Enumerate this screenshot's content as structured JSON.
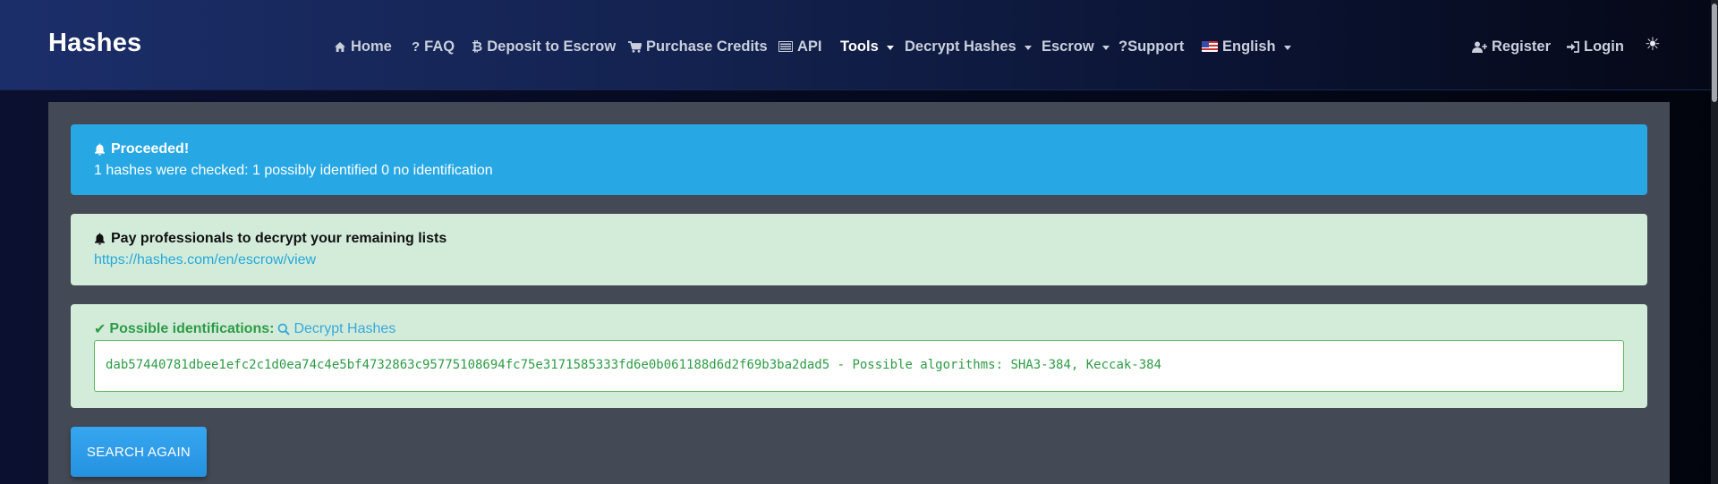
{
  "brand": "Hashes",
  "nav": {
    "home": "Home",
    "faq": "FAQ",
    "deposit": "Deposit to Escrow",
    "purchase": "Purchase Credits",
    "api": "API",
    "tools": "Tools",
    "decrypt": "Decrypt Hashes",
    "escrow": "Escrow",
    "support": "?Support",
    "language": "English",
    "register": "Register",
    "login": "Login"
  },
  "alerts": {
    "info_title": "Proceeded!",
    "info_body": "1 hashes were checked: 1 possibly identified 0 no identification",
    "pay_title": "Pay professionals to decrypt your remaining lists",
    "pay_link": "https://hashes.com/en/escrow/view",
    "success_title": "Possible identifications:",
    "success_link": "Decrypt Hashes",
    "result": "dab57440781dbee1efc2c1d0ea74c4e5bf4732863c95775108694fc75e3171585333fd6e0b061188d6d2f69b3ba2dad5 - Possible algorithms: SHA3-384, Keccak-384"
  },
  "search_again": "SEARCH AGAIN",
  "colors": {
    "info": "#27a8e5",
    "success_bg": "#d3ecda",
    "success_text": "#2e9b46",
    "link": "#25a8d9",
    "button": "#2592e0"
  },
  "icons": [
    "home-icon",
    "question-icon",
    "bitcoin-icon",
    "cart-icon",
    "api-icon",
    "flag-icon",
    "user-plus-icon",
    "login-icon",
    "sun-icon",
    "bell-icon",
    "check-icon",
    "search-icon"
  ]
}
